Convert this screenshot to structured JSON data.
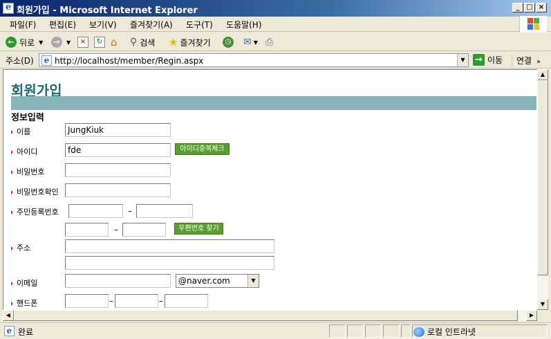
{
  "window": {
    "title": "회원가입 - Microsoft Internet Explorer"
  },
  "menu": [
    "파일(F)",
    "편집(E)",
    "보기(V)",
    "즐겨찾기(A)",
    "도구(T)",
    "도움말(H)"
  ],
  "toolbar": {
    "back": "뒤로",
    "search": "검색",
    "favorites": "즐겨찾기"
  },
  "address": {
    "label": "주소(D)",
    "url": "http://localhost/member/Regin.aspx",
    "go": "이동",
    "links": "연결"
  },
  "page": {
    "title": "회원가입",
    "section": "정보입력",
    "fields": {
      "name_label": "이름",
      "name_value": "JungKiuk",
      "id_label": "아이디",
      "id_value": "fde",
      "id_check_button": "아이디중복체크",
      "password_label": "비밀번호",
      "password_confirm_label": "비밀번호확인",
      "resident_label": "주민등록번호",
      "dash": "–",
      "zip_search_button": "우편번호 찾기",
      "address_label": "주소",
      "email_label": "이메일",
      "email_domain": "@naver.com",
      "phone_label": "핸드폰"
    }
  },
  "status": {
    "text": "완료",
    "zone": "로컬 인트라넷"
  },
  "colors": {
    "title_teal": "#1a6a72",
    "band": "#8ab3ba",
    "button_green": "#5a9e2f",
    "bullet_red": "#c0392b"
  }
}
